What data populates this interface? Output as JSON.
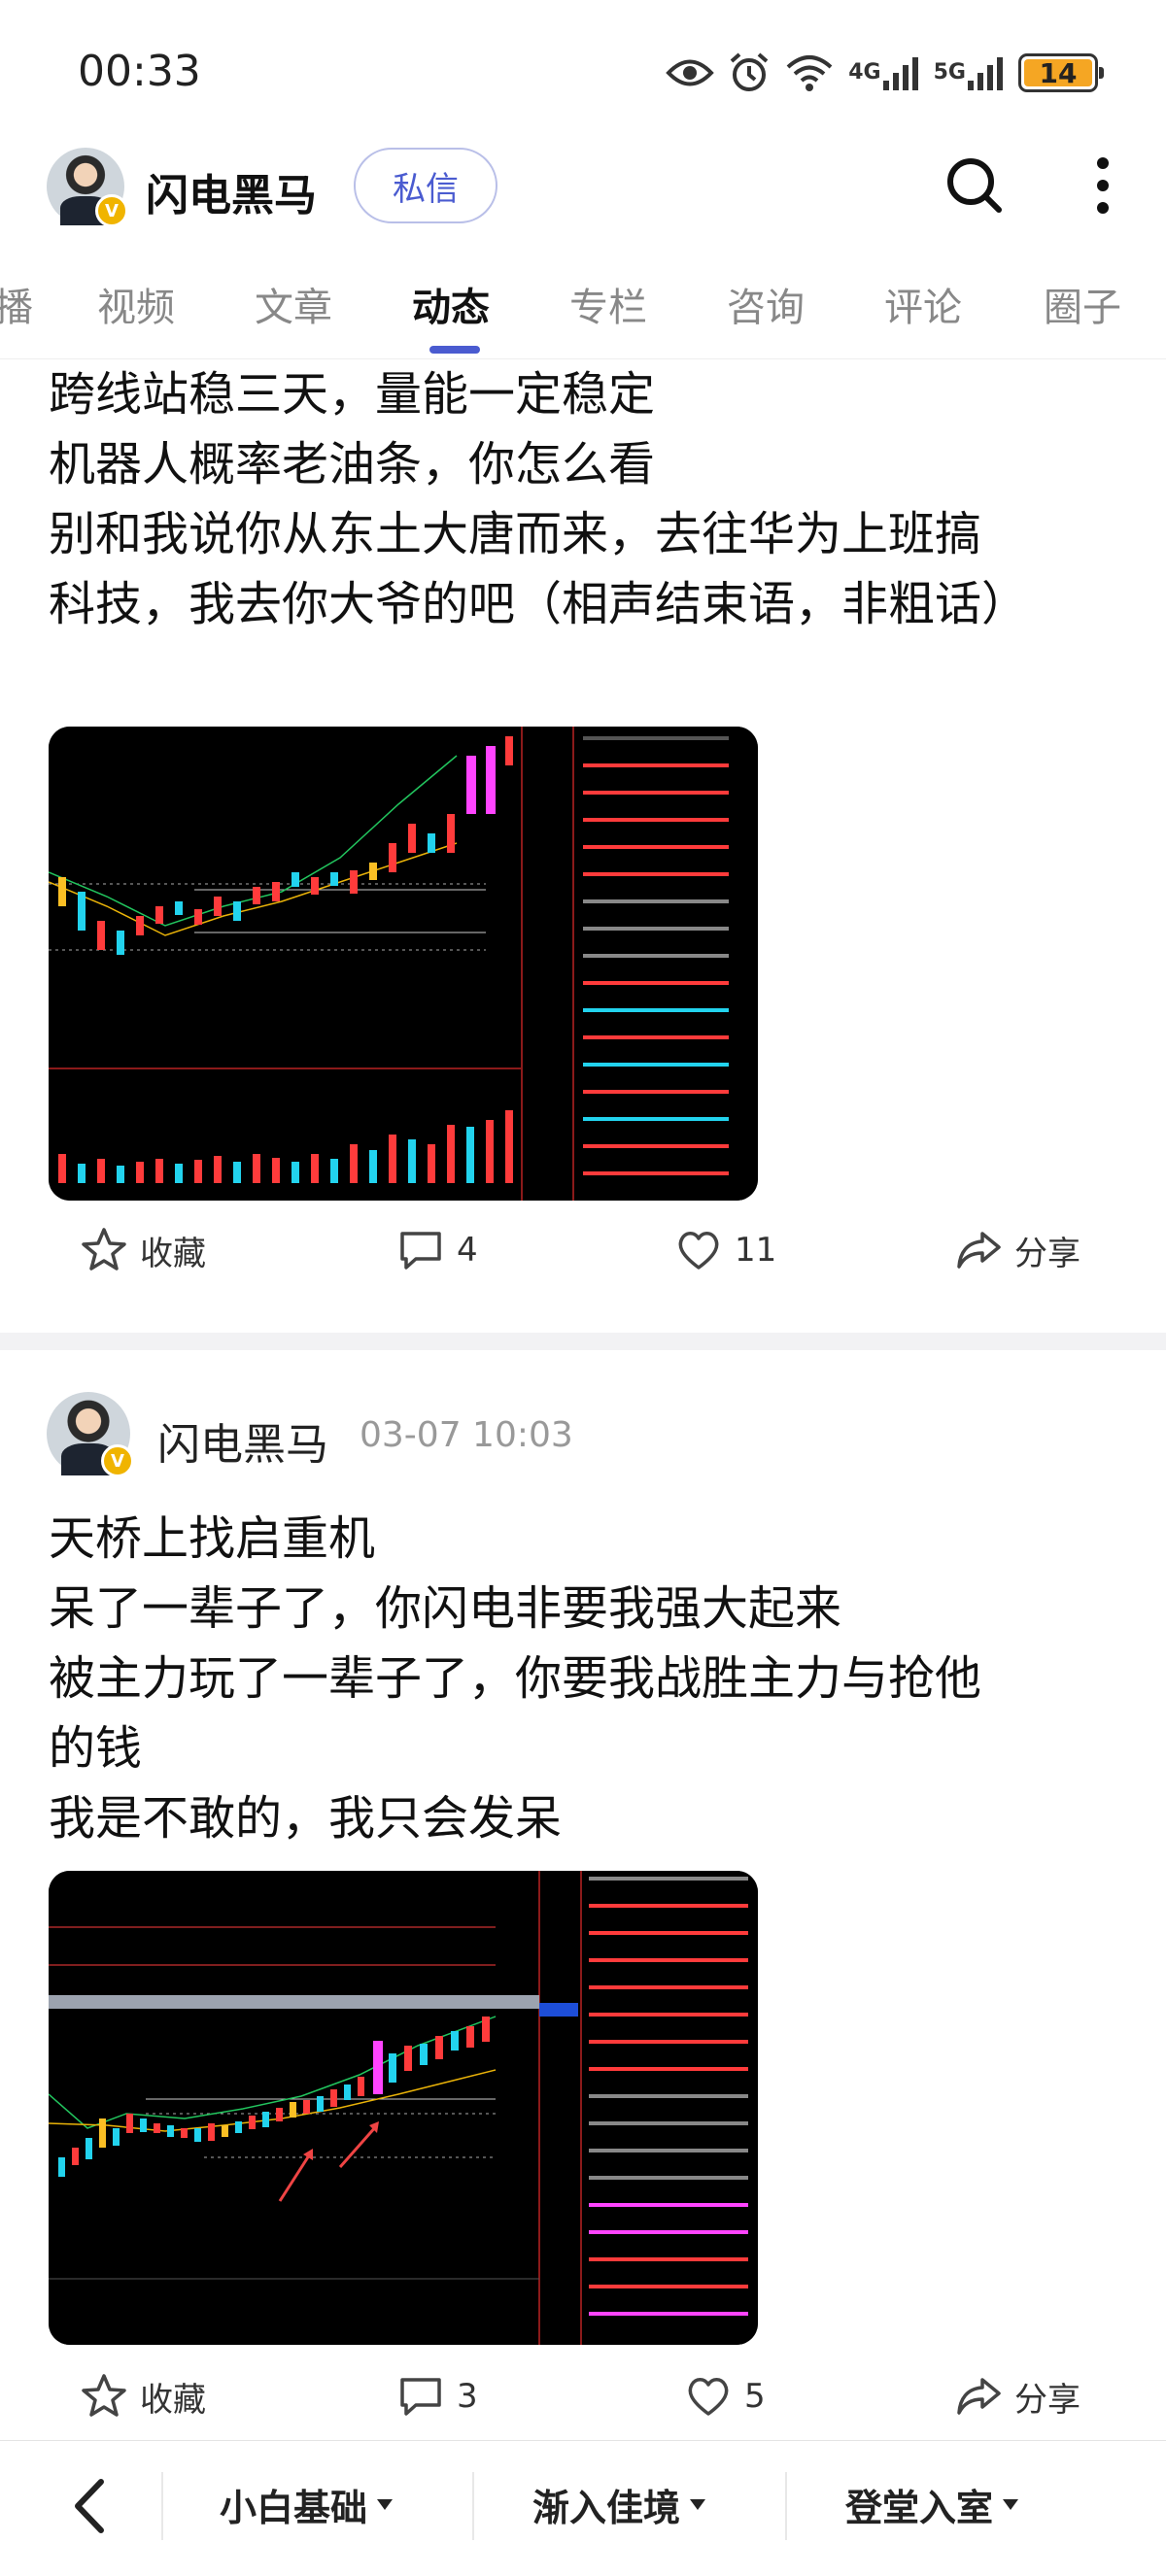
{
  "status_bar": {
    "time": "00:33",
    "network_4g": "4G",
    "network_5g": "5G",
    "battery": "14",
    "battery_level_percent": 14,
    "icons": [
      "eye-icon",
      "alarm-icon",
      "wifi-icon",
      "signal-icon",
      "signal-icon",
      "battery-icon"
    ]
  },
  "header": {
    "name": "闪电黑马",
    "dm_label": "私信",
    "verified_badge": "V",
    "icons": [
      "search-icon",
      "more-icon"
    ]
  },
  "tabs": [
    {
      "label": "播",
      "active": false
    },
    {
      "label": "视频",
      "active": false
    },
    {
      "label": "文章",
      "active": false
    },
    {
      "label": "动态",
      "active": true
    },
    {
      "label": "专栏",
      "active": false
    },
    {
      "label": "咨询",
      "active": false
    },
    {
      "label": "评论",
      "active": false
    },
    {
      "label": "圈子",
      "active": false
    }
  ],
  "posts": [
    {
      "lines": [
        "跨线站稳三天，量能一定稳定",
        "机器人概率老油条，你怎么看",
        "别和我说你从东土大唐而来，去往华为上班搞",
        "科技，我去你大爷的吧（相声结束语，非粗话）"
      ],
      "actions": {
        "favorite": "收藏",
        "comments": "4",
        "likes": "11",
        "share": "分享"
      }
    },
    {
      "author": "闪电黑马",
      "time": "03-07 10:03",
      "lines": [
        "天桥上找启重机",
        "呆了一辈子了，你闪电非要我强大起来",
        "被主力玩了一辈子了，你要我战胜主力与抢他",
        "的钱",
        "我是不敢的，我只会发呆"
      ],
      "actions": {
        "favorite": "收藏",
        "comments": "3",
        "likes": "5",
        "share": "分享"
      }
    }
  ],
  "bottom_bar": {
    "menu1": "小白基础",
    "menu2": "渐入佳境",
    "menu3": "登堂入室"
  },
  "colors": {
    "accent": "#4a5bd0",
    "candle_up": "#ff3b3b",
    "candle_down": "#22d3ee",
    "highlight": "#ff44ff",
    "chart_bg": "#000000"
  }
}
